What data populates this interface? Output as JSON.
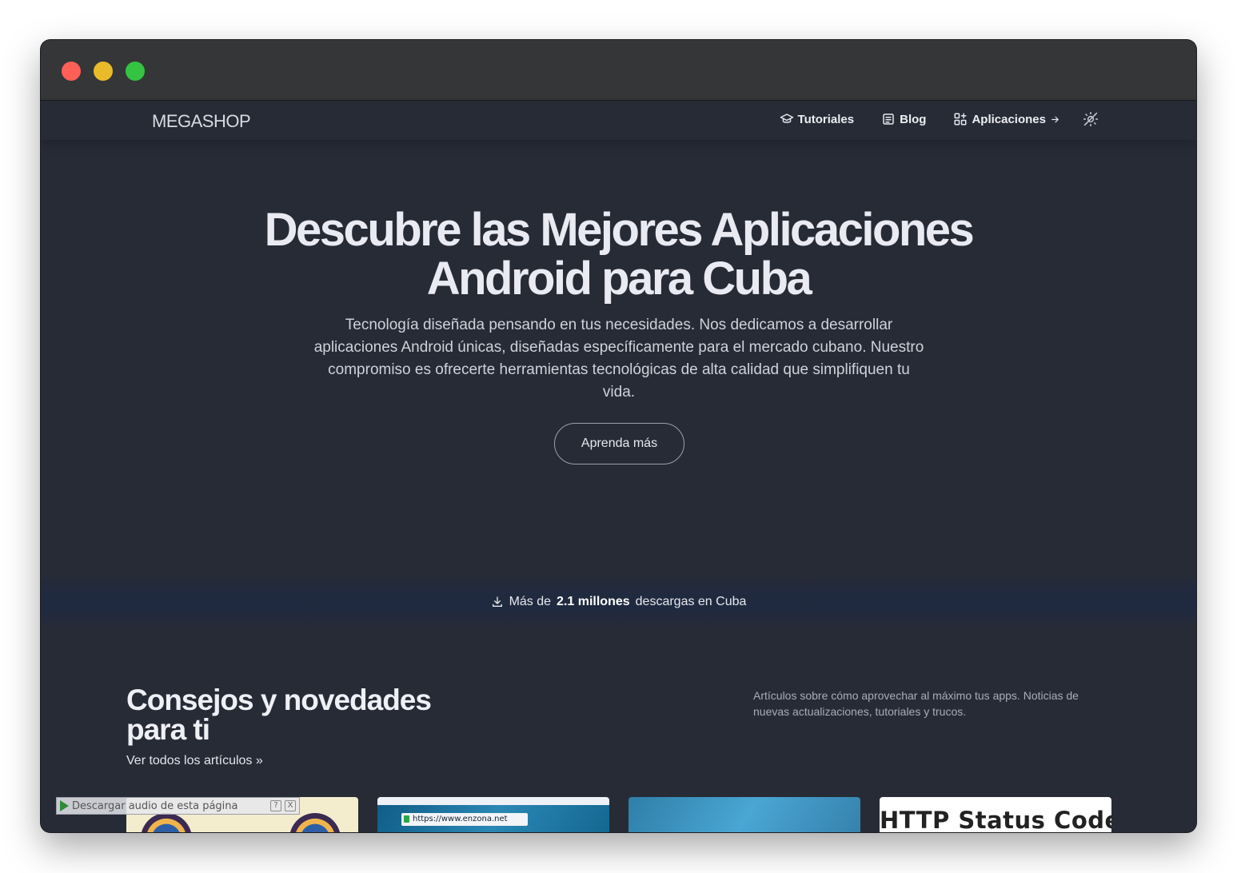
{
  "browser": {
    "controls": [
      "close",
      "minimize",
      "maximize"
    ]
  },
  "navbar": {
    "logo": "MEGASHOP",
    "links": [
      {
        "label": "Tutoriales",
        "icon": "graduation-cap-icon"
      },
      {
        "label": "Blog",
        "icon": "newspaper-icon"
      },
      {
        "label": "Aplicaciones",
        "icon": "grid-icon",
        "trailing_icon": "arrow-right-icon"
      }
    ],
    "theme_toggle_icon": "sun-moon-icon"
  },
  "hero": {
    "title_line1": "Descubre las Mejores Aplicaciones",
    "title_line2": "Android para Cuba",
    "description": "Tecnología diseñada pensando en tus necesidades. Nos dedicamos a desarrollar aplicaciones Android únicas, diseñadas específicamente para el mercado cubano. Nuestro compromiso es ofrecerte herramientas tecnológicas de alta calidad que simplifiquen tu vida.",
    "button_label": "Aprenda más"
  },
  "stats": {
    "prefix": "Más de",
    "highlight": "2.1 millones",
    "suffix": "descargas en Cuba",
    "icon": "download-icon"
  },
  "section": {
    "title": "Consejos y novedades para ti",
    "link_label": "Ver todos los artículos »",
    "description": "Artículos sobre cómo aprovechar al máximo tus apps. Noticias de nuevas actualizaciones, tutoriales y trucos."
  },
  "cards": {
    "card2_url": "https://www.enzona.net",
    "card4_title": "HTTP Status Codes"
  },
  "audio_overlay": {
    "label": "Descargar audio de esta página",
    "help": "?",
    "close": "X"
  },
  "colors": {
    "background": "#272b36",
    "text": "#e9eaf2",
    "close": "#fe5f57",
    "minimize": "#e9bb2a",
    "maximize": "#35c442"
  }
}
